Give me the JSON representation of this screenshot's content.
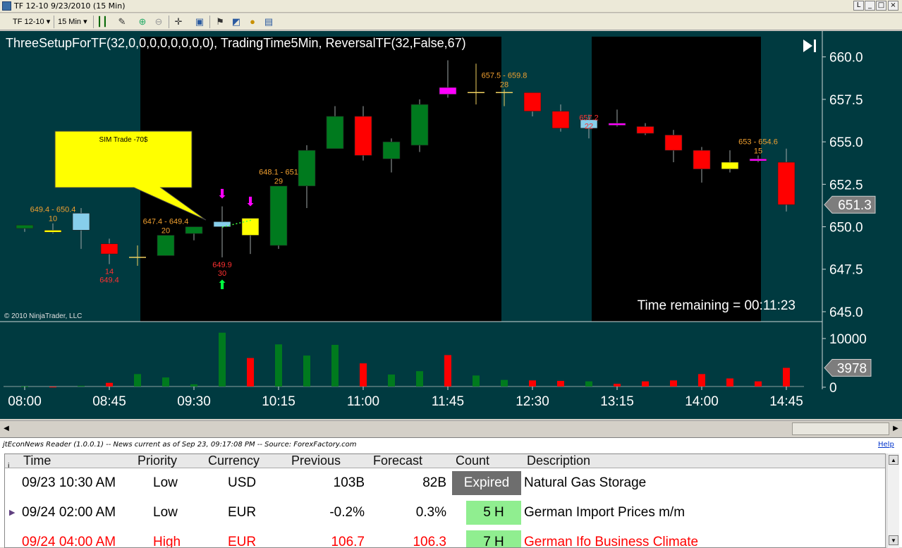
{
  "window": {
    "title": "TF 12-10  9/23/2010 (15 Min)",
    "buttons": [
      "L",
      "_",
      "□",
      "×"
    ]
  },
  "toolbar": {
    "instrument": "TF 12-10",
    "interval": "15 Min",
    "icons": [
      "bar-type-icon",
      "draw-icon",
      "zoom-in-icon",
      "zoom-out-icon",
      "crosshair-icon",
      "properties-icon",
      "strategy-icon",
      "indicator-icon",
      "money-icon",
      "data-box-icon"
    ]
  },
  "chart": {
    "indicator_label": "ThreeSetupForTF(32,0,0,0,0,0,0,0,0), TradingTime5Min, ReversalTF(32,False,67)",
    "copyright": "© 2010 NinjaTrader, LLC",
    "time_remaining": "Time remaining = 00:11:23",
    "sim_trade": "SIM Trade -70$",
    "last_price": "651.3",
    "last_volume": "3978",
    "colors": {
      "background": "#003a40",
      "session_block": "#000000",
      "up": "#007a1e",
      "down": "#ff0000",
      "yellow": "#ffff00",
      "light_blue": "#87ceeb",
      "magenta": "#ff00ff",
      "label_orange": "#f0a030"
    },
    "annotations": [
      {
        "text": "649.4 - 650.4",
        "bar": 1,
        "pos": "above"
      },
      {
        "text": "10",
        "bar": 1,
        "pos": "above2"
      },
      {
        "text": "14",
        "bar": 3,
        "pos": "below"
      },
      {
        "text": "649.4",
        "bar": 3,
        "pos": "below2"
      },
      {
        "text": "647.4 - 649.4",
        "bar": 5,
        "pos": "above"
      },
      {
        "text": "20",
        "bar": 5,
        "pos": "above2"
      },
      {
        "text": "649.9",
        "bar": 7,
        "pos": "below"
      },
      {
        "text": "30",
        "bar": 7,
        "pos": "below2"
      },
      {
        "text": "648.1 - 651",
        "bar": 9,
        "pos": "above"
      },
      {
        "text": "29",
        "bar": 9,
        "pos": "above2"
      },
      {
        "text": "657.5 - 659.8",
        "bar": 17,
        "pos": "above"
      },
      {
        "text": "28",
        "bar": 17,
        "pos": "above2"
      },
      {
        "text": "657.2",
        "bar": 20,
        "pos": "mid"
      },
      {
        "text": "22",
        "bar": 20,
        "pos": "mid2"
      },
      {
        "text": "653 - 654.6",
        "bar": 26,
        "pos": "above"
      },
      {
        "text": "15",
        "bar": 26,
        "pos": "above2"
      }
    ]
  },
  "chart_data": {
    "type": "candlestick",
    "x_ticks": [
      "08:00",
      "08:45",
      "09:30",
      "10:15",
      "11:00",
      "11:45",
      "12:30",
      "13:15",
      "14:00",
      "14:45"
    ],
    "y_ticks": [
      "660.0",
      "657.5",
      "655.0",
      "652.5",
      "650.0",
      "647.5",
      "645.0"
    ],
    "ylim": [
      644.5,
      660.9
    ],
    "volume_ticks": [
      "10000",
      "0"
    ],
    "volume_lim": [
      0,
      12000
    ],
    "session_blocks": [
      [
        4.1,
        16.9
      ],
      [
        20.1,
        26.1
      ]
    ],
    "bars": [
      {
        "o": 649.9,
        "h": 650.1,
        "l": 649.7,
        "c": 650.1,
        "color": "up",
        "v": 150
      },
      {
        "o": 649.8,
        "h": 650.2,
        "l": 649.6,
        "c": 649.8,
        "color": "yellow",
        "v": 100
      },
      {
        "o": 650.8,
        "h": 651.1,
        "l": 648.7,
        "c": 649.8,
        "color": "light_blue",
        "v": 300
      },
      {
        "o": 649.0,
        "h": 649.3,
        "l": 647.8,
        "c": 648.4,
        "color": "down",
        "v": 900
      },
      {
        "o": 648.2,
        "h": 648.9,
        "l": 647.7,
        "c": 648.2,
        "color": "cross",
        "v": 2700
      },
      {
        "o": 648.3,
        "h": 649.5,
        "l": 648.3,
        "c": 649.5,
        "color": "up",
        "v": 2000
      },
      {
        "o": 649.6,
        "h": 650.0,
        "l": 649.2,
        "c": 650.0,
        "color": "up",
        "v": 600
      },
      {
        "o": 650.3,
        "h": 651.2,
        "l": 648.2,
        "c": 650.0,
        "color": "light_blue",
        "v": 11200
      },
      {
        "o": 649.5,
        "h": 650.5,
        "l": 648.4,
        "c": 650.5,
        "color": "yellow",
        "v": 6000
      },
      {
        "o": 648.9,
        "h": 652.4,
        "l": 648.7,
        "c": 652.4,
        "color": "up",
        "v": 8800
      },
      {
        "o": 652.4,
        "h": 654.8,
        "l": 651.1,
        "c": 654.5,
        "color": "up",
        "v": 6500
      },
      {
        "o": 654.6,
        "h": 657.1,
        "l": 654.6,
        "c": 656.5,
        "color": "up",
        "v": 8700
      },
      {
        "o": 656.5,
        "h": 657.1,
        "l": 653.9,
        "c": 654.2,
        "color": "down",
        "v": 4900
      },
      {
        "o": 654.0,
        "h": 655.2,
        "l": 653.2,
        "c": 655.0,
        "color": "up",
        "v": 2600
      },
      {
        "o": 654.8,
        "h": 657.5,
        "l": 654.4,
        "c": 657.2,
        "color": "up",
        "v": 3300
      },
      {
        "o": 657.8,
        "h": 659.8,
        "l": 657.6,
        "c": 658.2,
        "color": "magenta",
        "v": 6600
      },
      {
        "o": 657.9,
        "h": 659.6,
        "l": 657.2,
        "c": 657.9,
        "color": "cross",
        "v": 2400
      },
      {
        "o": 657.9,
        "h": 658.1,
        "l": 657.1,
        "c": 657.9,
        "color": "cross",
        "v": 1500
      },
      {
        "o": 657.9,
        "h": 657.9,
        "l": 656.5,
        "c": 656.8,
        "color": "down",
        "v": 1400
      },
      {
        "o": 656.8,
        "h": 657.2,
        "l": 655.6,
        "c": 655.8,
        "color": "down",
        "v": 1300
      },
      {
        "o": 656.3,
        "h": 656.6,
        "l": 655.2,
        "c": 655.8,
        "color": "light_blue",
        "v": 1200
      },
      {
        "o": 656.1,
        "h": 656.9,
        "l": 655.9,
        "c": 656.0,
        "color": "magenta",
        "v": 700
      },
      {
        "o": 655.9,
        "h": 656.1,
        "l": 655.4,
        "c": 655.5,
        "color": "down",
        "v": 1200
      },
      {
        "o": 655.4,
        "h": 655.7,
        "l": 653.8,
        "c": 654.5,
        "color": "down",
        "v": 1400
      },
      {
        "o": 654.5,
        "h": 654.7,
        "l": 652.6,
        "c": 653.4,
        "color": "down",
        "v": 2700
      },
      {
        "o": 653.8,
        "h": 654.5,
        "l": 653.2,
        "c": 653.4,
        "color": "yellow",
        "v": 1800
      },
      {
        "o": 654.0,
        "h": 654.2,
        "l": 653.8,
        "c": 654.0,
        "color": "magenta",
        "v": 1200
      },
      {
        "o": 653.8,
        "h": 654.6,
        "l": 650.9,
        "c": 651.3,
        "color": "down",
        "v": 3978
      }
    ]
  },
  "news": {
    "caption": "jtEconNews Reader (1.0.0.1)  --  News current as of Sep 23, 09:17:08 PM  --  Source: ForexFactory.com",
    "help": "Help",
    "columns": [
      "i",
      "Time",
      "Priority",
      "Currency",
      "Previous",
      "Forecast",
      "Count",
      "Description"
    ],
    "rows": [
      {
        "time": "09/23 10:30 AM",
        "priority": "Low",
        "currency": "USD",
        "previous": "103B",
        "forecast": "82B",
        "count": "Expired",
        "description": "Natural Gas Storage",
        "count_style": "expired",
        "text_color": "#000000"
      },
      {
        "time": "09/24 02:00 AM",
        "priority": "Low",
        "currency": "EUR",
        "previous": "-0.2%",
        "forecast": "0.3%",
        "count": "5 H",
        "description": "German Import Prices m/m",
        "count_style": "pending",
        "text_color": "#000000"
      },
      {
        "time": "09/24 04:00 AM",
        "priority": "High",
        "currency": "EUR",
        "previous": "106.7",
        "forecast": "106.3",
        "count": "7 H",
        "description": "German Ifo Business Climate",
        "count_style": "pending",
        "text_color": "#ff0000"
      }
    ]
  }
}
